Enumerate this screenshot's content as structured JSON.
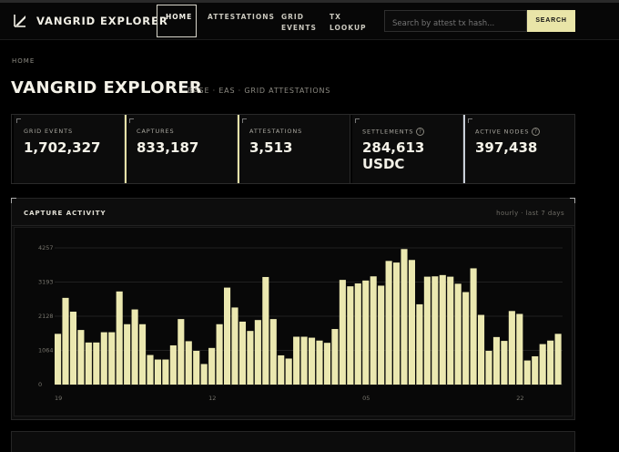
{
  "header": {
    "brand": "VANGRID EXPLORER",
    "nav": [
      {
        "label": "HOME",
        "active": true
      },
      {
        "label": "ATTESTATIONS"
      },
      {
        "label": "GRID\nEVENTS"
      },
      {
        "label": "TX\nLOOKUP"
      }
    ],
    "search": {
      "placeholder": "Search by attest tx hash...",
      "button_label": "SEARCH"
    }
  },
  "breadcrumb": "HOME",
  "page": {
    "title": "VANGRID EXPLORER",
    "subtitle": "BASE · EAS · GRID ATTESTATIONS"
  },
  "stats": [
    {
      "label": "GRID EVENTS",
      "value": "1,702,327",
      "accent": "#000000"
    },
    {
      "label": "CAPTURES",
      "value": "833,187",
      "accent": "#e6e2a8"
    },
    {
      "label": "ATTESTATIONS",
      "value": "3,513",
      "accent": "#e6e2a8"
    },
    {
      "label": "SETTLEMENTS",
      "value": "284,613\nUSDC",
      "accent": "#000000",
      "help": "?"
    },
    {
      "label": "ACTIVE NODES",
      "value": "397,438",
      "accent": "#c9cfd8",
      "help": "?"
    }
  ],
  "panel": {
    "title": "CAPTURE ACTIVITY",
    "meta": "hourly · last 7 days"
  },
  "colors": {
    "accent": "#e9e5a8",
    "bar": "#ebe8b0",
    "grid": "#2a2a2a"
  },
  "chart_data": {
    "type": "bar",
    "title": "CAPTURE ACTIVITY",
    "xlabel": "",
    "ylabel": "",
    "ylim": [
      0,
      4257
    ],
    "yticks": [
      0,
      1064,
      2128,
      3193,
      4257
    ],
    "ytick_labels": [
      "0",
      "1064",
      "2128",
      "3193",
      "4257"
    ],
    "xtick_labels": [
      {
        "label": "19",
        "index": 0
      },
      {
        "label": "12",
        "index": 20
      },
      {
        "label": "05",
        "index": 40
      },
      {
        "label": "22",
        "index": 60
      }
    ],
    "values": [
      1580,
      2700,
      2270,
      1700,
      1310,
      1310,
      1630,
      1630,
      2900,
      1880,
      2340,
      1880,
      920,
      780,
      780,
      1220,
      2040,
      1350,
      1050,
      640,
      1140,
      1880,
      3020,
      2400,
      1960,
      1670,
      2010,
      3350,
      2040,
      910,
      810,
      1490,
      1490,
      1460,
      1370,
      1300,
      1730,
      3260,
      3060,
      3150,
      3240,
      3370,
      3080,
      3850,
      3800,
      4220,
      3880,
      2500,
      3360,
      3370,
      3410,
      3360,
      3140,
      2880,
      3620,
      2170,
      1050,
      1480,
      1360,
      2290,
      2200,
      750,
      880,
      1260,
      1370,
      1580
    ]
  }
}
